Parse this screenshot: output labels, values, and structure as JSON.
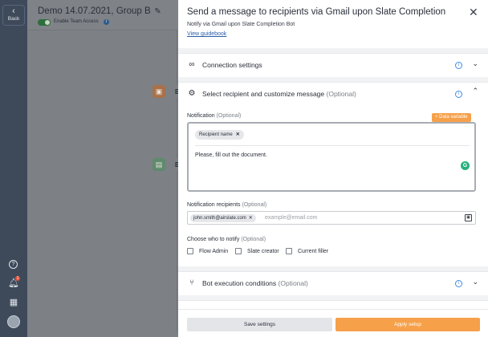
{
  "sidebar": {
    "back_label": "Back",
    "back_icon": "chevron-left-icon",
    "icons": [
      "help-icon",
      "bell-icon",
      "calendar-icon",
      "avatar"
    ],
    "notification_count": "1"
  },
  "canvas": {
    "title": "Demo 14.07.2021, Group B",
    "team_access_label": "Enable Team Access",
    "node_labels": [
      "B",
      "B"
    ],
    "toggle_color": "#2d6e3a"
  },
  "drawer": {
    "title": "Send a message to recipients via Gmail upon Slate Completion",
    "subtitle": "Notify via Gmail upon Slate Completion Bot",
    "guidebook_link": "View guidebook",
    "sections": {
      "connection": {
        "title": "Connection settings"
      },
      "recipient": {
        "title": "Select recipient and customize message",
        "optional": "(Optional)"
      },
      "conditions": {
        "title": "Bot execution conditions",
        "optional": "(Optional)"
      }
    },
    "notification": {
      "label": "Notification",
      "optional": "(Optional)",
      "data_variable_button": "+ Data variable",
      "chip": "Recipient name",
      "message": "Please, fill out the document."
    },
    "recipients": {
      "label": "Notification recipients",
      "optional": "(Optional)",
      "email_chip": "john.smith@airslate.com",
      "placeholder": "example@email.com"
    },
    "notify": {
      "label": "Choose who to notify",
      "optional": "(Optional)",
      "options": [
        "Flow Admin",
        "Slate creator",
        "Current filler"
      ]
    },
    "footer": {
      "save_label": "Save settings",
      "apply_label": "Apply setup"
    }
  },
  "colors": {
    "accent_orange": "#f6a04a",
    "link_blue": "#2a5ea8",
    "info_blue": "#3e8be0",
    "sidebar_dark": "#3e4a5a"
  }
}
